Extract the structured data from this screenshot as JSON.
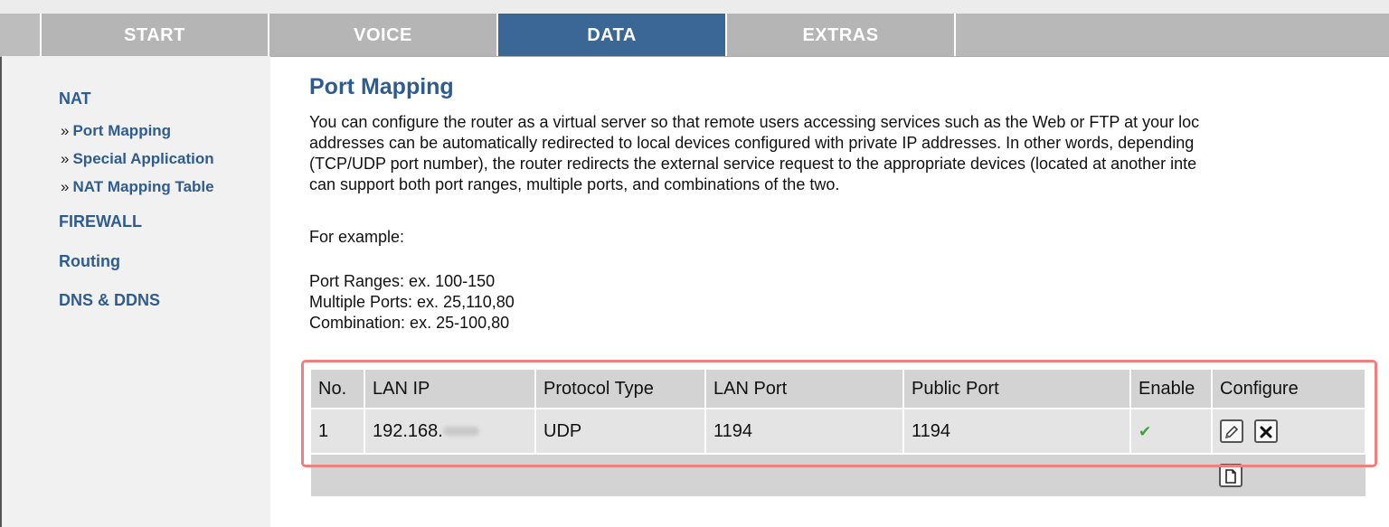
{
  "nav": {
    "tabs": [
      {
        "label": "START"
      },
      {
        "label": "VOICE"
      },
      {
        "label": "DATA"
      },
      {
        "label": "EXTRAS"
      }
    ],
    "active_tab": "DATA",
    "active_color": "#3a6796"
  },
  "sidebar": {
    "nat": "NAT",
    "port_mapping": "Port Mapping",
    "special_application": "Special Application",
    "nat_mapping_table": "NAT Mapping Table",
    "firewall": "FIREWALL",
    "routing": "Routing",
    "dns_ddns": "DNS & DDNS",
    "bullet": "»"
  },
  "main": {
    "title": "Port Mapping",
    "description_lines": [
      "You can configure the router as a virtual server so that remote users accessing services such as the Web or FTP at your loc",
      "addresses can be automatically redirected to local devices configured with private IP addresses. In other words, depending",
      "(TCP/UDP port number), the router redirects the external service request to the appropriate devices (located at another inte",
      "can support both port ranges, multiple ports, and combinations of the two."
    ],
    "example_label": "For example:",
    "examples": [
      "Port Ranges: ex. 100-150",
      "Multiple Ports: ex. 25,110,80",
      "Combination: ex. 25-100,80"
    ]
  },
  "table": {
    "headers": [
      "No.",
      "LAN IP",
      "Protocol Type",
      "LAN Port",
      "Public Port",
      "Enable",
      "Configure"
    ],
    "rows": [
      {
        "no": "1",
        "lan_ip": "192.168.",
        "protocol": "UDP",
        "lan_port": "1194",
        "public_port": "1194",
        "enabled": true
      }
    ],
    "icons": {
      "enabled": "check-icon",
      "edit": "pencil-icon",
      "delete": "x-icon",
      "add": "new-document-icon"
    }
  }
}
